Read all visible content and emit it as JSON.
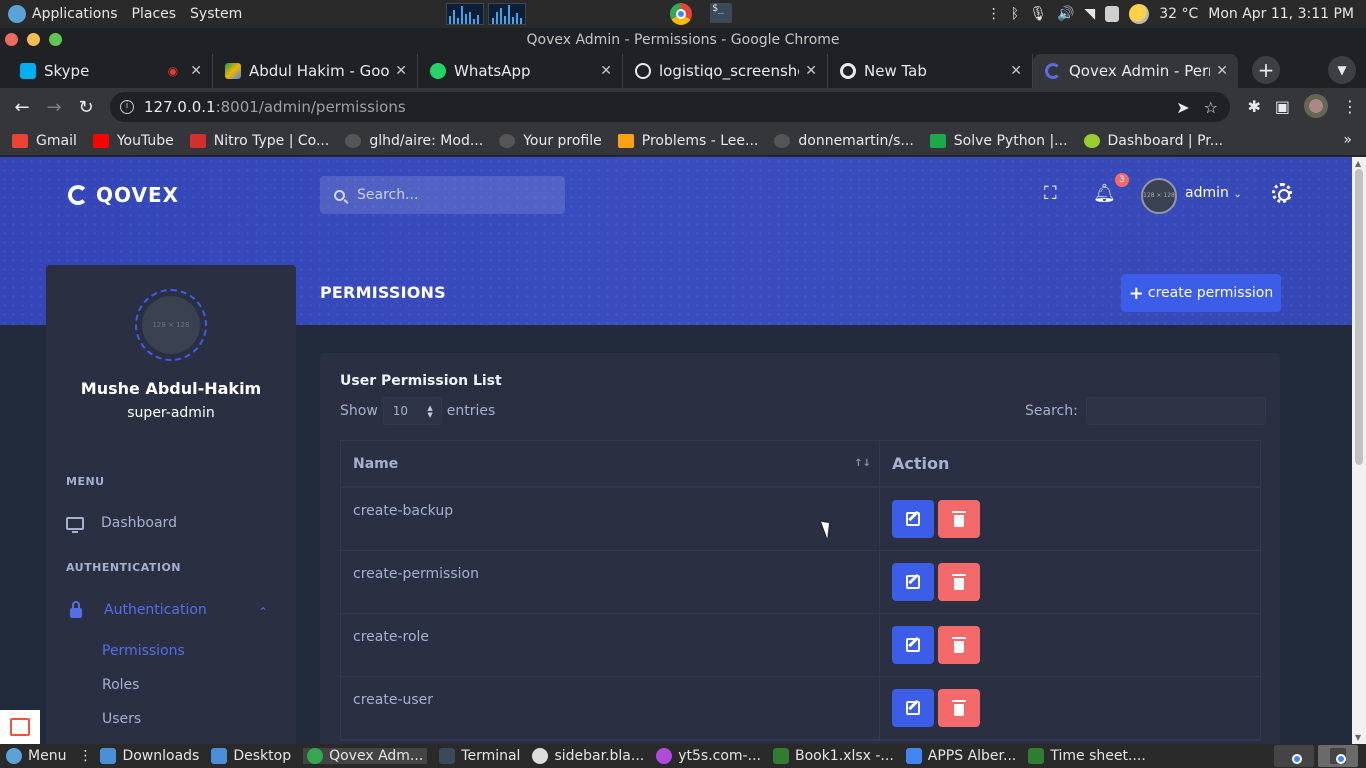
{
  "os": {
    "menus": [
      "Applications",
      "Places",
      "System"
    ],
    "temperature": "32 °C",
    "datetime": "Mon Apr 11, 3:11 PM"
  },
  "window": {
    "title": "Qovex Admin - Permissions - Google Chrome"
  },
  "tabs": [
    {
      "label": "Skype",
      "color": "#00aff0"
    },
    {
      "label": "Abdul Hakim - Googl",
      "color": "#f4b400"
    },
    {
      "label": "WhatsApp",
      "color": "#25d366"
    },
    {
      "label": "logistiqo_screenshot",
      "color": "#e8eaed"
    },
    {
      "label": "New Tab",
      "color": "#e8eaed"
    },
    {
      "label": "Qovex Admin - Perm",
      "color": "#556ee6"
    }
  ],
  "address": {
    "host": "127.0.0.1",
    "port": ":8001",
    "path": "/admin/permissions"
  },
  "bookmarks": [
    {
      "label": "Gmail",
      "color": "#ea4335"
    },
    {
      "label": "YouTube",
      "color": "#ff0000"
    },
    {
      "label": "Nitro Type | Co...",
      "color": "#d32f2f"
    },
    {
      "label": "glhd/aire: Mod...",
      "color": "#555"
    },
    {
      "label": "Your profile",
      "color": "#555"
    },
    {
      "label": "Problems - Lee...",
      "color": "#ffa116"
    },
    {
      "label": "donnemartin/s...",
      "color": "#555"
    },
    {
      "label": "Solve Python |...",
      "color": "#1ba94c"
    },
    {
      "label": "Dashboard | Pr...",
      "color": "#9acd32"
    }
  ],
  "header": {
    "brand": "QOVEX",
    "search_placeholder": "Search...",
    "notification_count": "3",
    "avatar_text": "128 × 128",
    "username": "admin"
  },
  "page": {
    "title": "PERMISSIONS",
    "create_label": "create permission"
  },
  "sidebar": {
    "avatar_text": "128 × 128",
    "name": "Mushe Abdul-Hakim",
    "role": "super-admin",
    "menu_heading": "MENU",
    "dashboard": "Dashboard",
    "auth_heading": "AUTHENTICATION",
    "auth_item": "Authentication",
    "sub": [
      "Permissions",
      "Roles",
      "Users"
    ]
  },
  "card": {
    "title": "User Permission List",
    "show_label": "Show",
    "page_size": "10",
    "entries_label": "entries",
    "search_label": "Search:",
    "columns": [
      "Name",
      "Action"
    ],
    "rows": [
      "create-backup",
      "create-permission",
      "create-role",
      "create-user"
    ]
  },
  "taskbar": [
    {
      "label": "Menu",
      "color": "#5aa3d8"
    },
    {
      "label": "Downloads",
      "color": "#4a90d9"
    },
    {
      "label": "Desktop",
      "color": "#4a90d9"
    },
    {
      "label": "Qovex Adm...",
      "color": "#34a853"
    },
    {
      "label": "Terminal",
      "color": "#3b4a59"
    },
    {
      "label": "sidebar.bla...",
      "color": "#ddd"
    },
    {
      "label": "yt5s.com-...",
      "color": "#b04ad9"
    },
    {
      "label": "Book1.xlsx -...",
      "color": "#2e7d32"
    },
    {
      "label": "APPS Alber...",
      "color": "#4285f4"
    },
    {
      "label": "Time sheet....",
      "color": "#2e7d32"
    }
  ]
}
